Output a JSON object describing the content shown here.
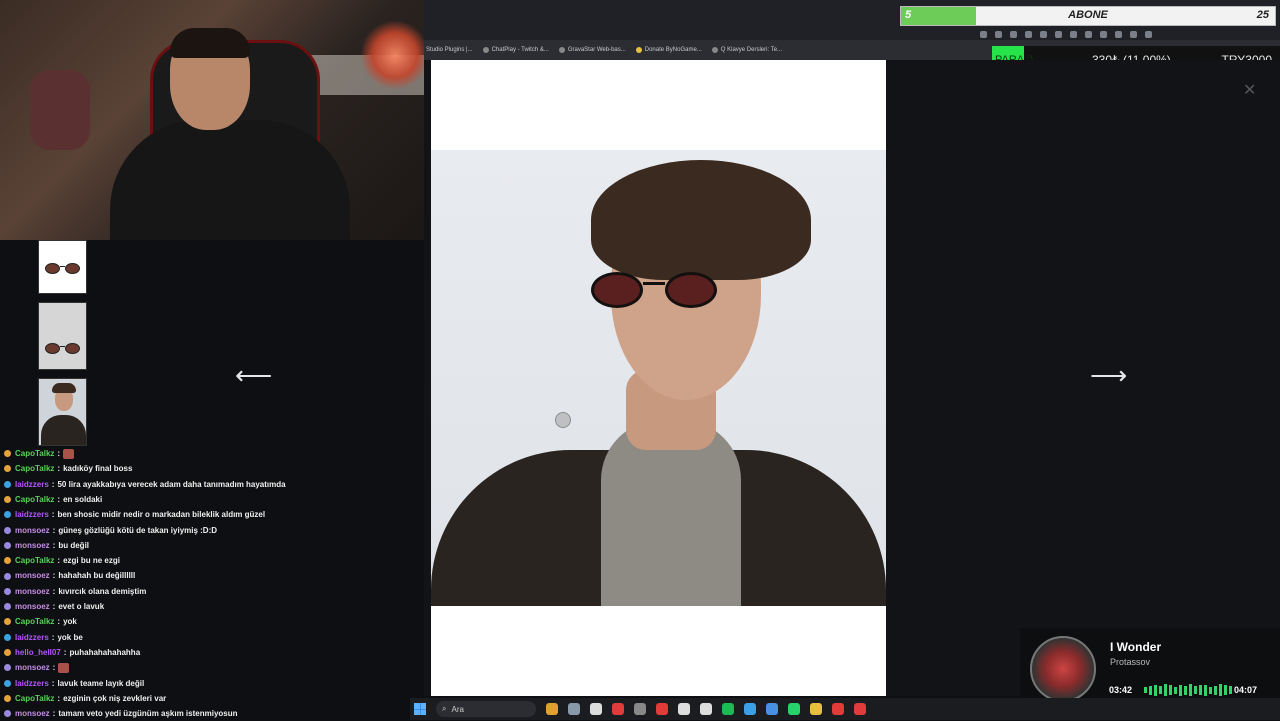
{
  "overlay": {
    "abone_start": "5",
    "abone_label": "ABONE",
    "abone_end": "25",
    "abone_progress": 0.2,
    "para_label": "PARA :)",
    "para_amount": "330₺ (11.00%)",
    "para_goal": "TRY3000"
  },
  "browser": {
    "bookmarks": [
      "Studio Plugins |...",
      "ChatPlay - Twitch &...",
      "GravaStar Web-bas...",
      "Donate ByNoGame...",
      "Q Klavye Dersleri: Te..."
    ]
  },
  "viewer": {
    "prev_arrow": "⟵",
    "next_arrow": "⟶",
    "close": "✕",
    "zoom_icon": "zoom-in-icon"
  },
  "chat": [
    {
      "user": "CapoTalkz",
      "color": "#5ad15a",
      "text": "",
      "emote": true,
      "badge": "#e8a23a"
    },
    {
      "user": "CapoTalkz",
      "color": "#5ad15a",
      "text": "kadıköy final boss",
      "badge": "#e8a23a"
    },
    {
      "user": "laidzzers",
      "color": "#b455ff",
      "text": "50 lira ayakkabıya verecek adam daha tanımadım hayatımda",
      "badge": "#3aa3e8"
    },
    {
      "user": "CapoTalkz",
      "color": "#5ad15a",
      "text": "en soldaki",
      "badge": "#e8a23a"
    },
    {
      "user": "laidzzers",
      "color": "#b455ff",
      "text": "ben shosic midir nedir o markadan bileklik aldım güzel",
      "badge": "#3aa3e8"
    },
    {
      "user": "monsoez",
      "color": "#c78de6",
      "text": "güneş gözlüğü kötü de takan iyiymiş :D:D",
      "badge": "#9a8adf"
    },
    {
      "user": "monsoez",
      "color": "#c78de6",
      "text": "bu değil",
      "badge": "#9a8adf"
    },
    {
      "user": "CapoTalkz",
      "color": "#5ad15a",
      "text": "ezgi bu ne ezgi",
      "badge": "#e8a23a"
    },
    {
      "user": "monsoez",
      "color": "#c78de6",
      "text": "hahahah bu değillllll",
      "badge": "#9a8adf"
    },
    {
      "user": "monsoez",
      "color": "#c78de6",
      "text": "kıvırcık olana demiştim",
      "badge": "#9a8adf"
    },
    {
      "user": "monsoez",
      "color": "#c78de6",
      "text": "evet o lavuk",
      "badge": "#9a8adf"
    },
    {
      "user": "CapoTalkz",
      "color": "#5ad15a",
      "text": "yok",
      "badge": "#e8a23a"
    },
    {
      "user": "laidzzers",
      "color": "#b455ff",
      "text": "yok be",
      "badge": "#3aa3e8"
    },
    {
      "user": "hello_hell07",
      "color": "#b455ff",
      "text": "puhahahahahahha",
      "badge": "#e8a23a"
    },
    {
      "user": "monsoez",
      "color": "#c78de6",
      "text": "",
      "emote": true,
      "badge": "#9a8adf"
    },
    {
      "user": "laidzzers",
      "color": "#b455ff",
      "text": "lavuk teame layık değil",
      "badge": "#3aa3e8"
    },
    {
      "user": "CapoTalkz",
      "color": "#5ad15a",
      "text": "ezginin çok niş zevkleri var",
      "badge": "#e8a23a"
    },
    {
      "user": "monsoez",
      "color": "#c78de6",
      "text": "tamam veto yedi üzgünüm aşkım istenmiyosun",
      "badge": "#9a8adf"
    }
  ],
  "music": {
    "title": "I Wonder",
    "artist": "Protassov",
    "elapsed": "03:42",
    "total": "04:07",
    "progress": 0.9
  },
  "taskbar": {
    "search_label": "Ara",
    "apps": [
      "#e0a030",
      "#8899aa",
      "#ddd",
      "#e03c3c",
      "#888",
      "#e03c3c",
      "#ddd",
      "#ddd",
      "#1db954",
      "#3ba0e8",
      "#4a90e2",
      "#25d366",
      "#e8c040",
      "#e03c3c",
      "#e03c3c"
    ]
  }
}
